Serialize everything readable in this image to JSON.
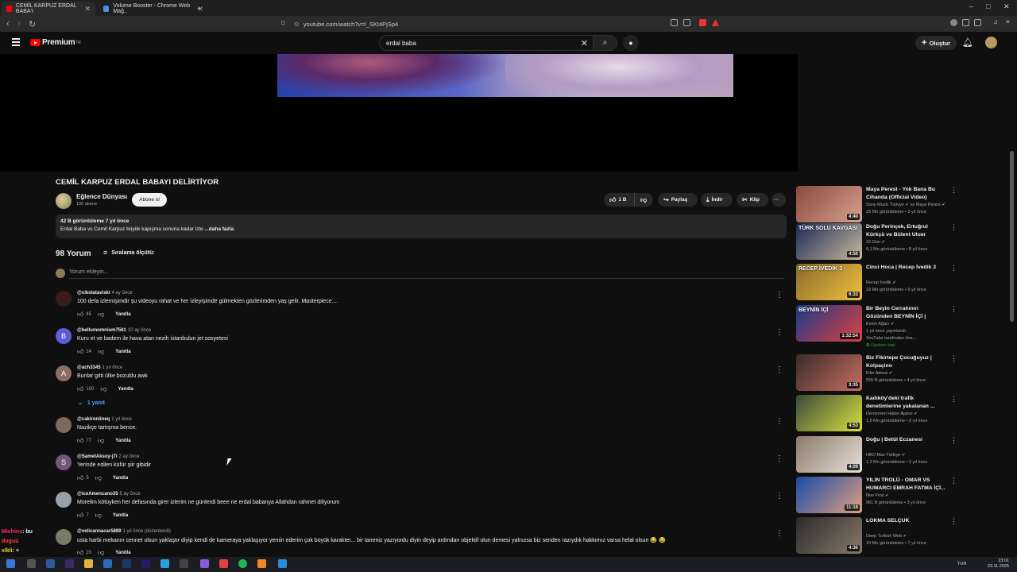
{
  "browser": {
    "tabs": [
      {
        "label": "CEMİL KARPUZ ERDAL BABA'I",
        "active": true
      },
      {
        "label": "Volume Booster - Chrome Web Mağ..",
        "active": false
      }
    ],
    "new_tab": "+",
    "url": "youtube.com/watch?v=I_SKt4PjSp4",
    "window_controls": [
      "–",
      "□",
      "✕"
    ]
  },
  "header": {
    "logo_text": "Premium",
    "logo_sup": "TR",
    "search_value": "erdal baba",
    "clear": "✕",
    "search_icon": "⌕",
    "mic_icon": "🎤",
    "create_label": "Oluştur",
    "create_icon": "+"
  },
  "video": {
    "title": "CEMİL KARPUZ ERDAL BABAYI DELİRTİYOR",
    "channel": "Eğlence Dünyası",
    "subscribers": "190 abone",
    "subscribe_label": "Abone ol",
    "actions": {
      "like": "1 B",
      "share": "Paylaş",
      "download": "İndir",
      "clip": "Klip",
      "more": "···"
    },
    "description": {
      "meta": "42 B görüntüleme  7 yıl önce",
      "text": "Erdal Baba vs Cemil Karpuz büyük kapışma sonuna kadar izle",
      "more": "...daha fazla"
    }
  },
  "comments": {
    "count": "98 Yorum",
    "sort_label": "Sıralama ölçütü:",
    "add_placeholder": "Yorum ekleyin...",
    "reply_label": "Yanıtla",
    "replies_link": "1 yanıt",
    "items": [
      {
        "user": "@cikolataviski",
        "time": "4 ay önce",
        "text": "100 defa izlemişimdir şu videoyu rahat ve her izleyişimde gülmekten gözlerimden yaş gelir. Masterpiece....",
        "likes": "45",
        "avatar": "",
        "avatar_color": "#3a1a1a"
      },
      {
        "user": "@bellumomnium7561",
        "time": "10 ay önce",
        "text": "Kuru et ve badem ile hava atan nezih istanbulun jet sosyetesi",
        "likes": "24",
        "avatar": "B",
        "avatar_color": "#5c5cd6"
      },
      {
        "user": "@ach3345",
        "time": "1 yıl önce",
        "text": "Bunlar gitti ülke bozuldu awk",
        "likes": "100",
        "avatar": "A",
        "avatar_color": "#8d6e63"
      },
      {
        "user": "@cakironlineq",
        "time": "1 yıl önce",
        "text": "Nazikçe tartışma bence.",
        "likes": "77",
        "avatar": "",
        "avatar_color": "#7a6a60"
      },
      {
        "user": "@SametAksoy-j7i",
        "time": "2 ay önce",
        "text": "Yerinde edilen küfür şiir gibidir",
        "likes": "5",
        "avatar": "S",
        "avatar_color": "#6d5a7a"
      },
      {
        "user": "@iceAmencano35",
        "time": "5 ay önce",
        "text": "Morelim kötüyken her defasında girer izlerim ne günlerdi beee ne erdal babanya Allahdan rahmet diliyorum",
        "likes": "7",
        "avatar": "",
        "avatar_color": "#9aa0a8"
      },
      {
        "user": "@velicannacar5889",
        "time": "1 yıl önce (düzenlendi)",
        "text": "usta harbi mekanın cennet olsun yaklaştır diyip kendi de kameraya yaklaşıyor yemin ederim çok büyük karakter... bir taneniz yazıyordu diyin deyip ardından objektif olun demesi yalnızsa biz senden razıydık hakkımız varsa helal olsun 😂 😂",
        "likes": "20",
        "avatar": "",
        "avatar_color": "#7a7a6a"
      }
    ]
  },
  "sidebar": [
    {
      "title": "Maya Perest - Yok Bana Bu Cihanda (Official Video)",
      "channel": "Sony Music Türkiye ✔ ve Maya Perest ✔",
      "meta": "25 Mn görüntüleme • 3 yıl önce",
      "duration": "4:40",
      "thumb": "#8a4a3a",
      "thumb2": "#d8a090"
    },
    {
      "title": "Doğu Perinçek, Ertuğrul Kürkçü ve Bülent Uluer Kavgası | ...",
      "channel": "32.Gün ✔",
      "meta": "6,1 Mn görüntüleme • 8 yıl önce",
      "duration": "4:50",
      "thumb": "#1a2a5a",
      "thumb2": "#c9b89a",
      "overlay": "TÜRK SOLU KAVGASI"
    },
    {
      "title": "Cinci Hoca | Recep İvedik 3",
      "channel": "Recep İvedik ✔",
      "meta": "19 Mn görüntüleme • 9 yıl önce",
      "duration": "6:32",
      "thumb": "#8a6a2a",
      "thumb2": "#f0c040",
      "overlay": "RECEP İVEDİK 3"
    },
    {
      "title": "Bir Beyin Cerrahının Gözünden BEYNİN İÇİ | Mehmet Çağlar ...",
      "channel": "Evrim Ağacı ✔",
      "meta": "1 yıl önce yayınlandı",
      "meta2": "YouTube tarafından öne...",
      "badge": "✪ Üyelere özel",
      "duration": "1:32:54",
      "thumb": "#1a3a8a",
      "thumb2": "#e04040",
      "overlay": "BEYNİN İÇİ"
    },
    {
      "title": "Biz Fikirtepe Çocuğuyuz | Kolpaçino",
      "channel": "Film Adresi ✔",
      "meta": "555 B görüntüleme • 4 yıl önce",
      "duration": "3:35",
      "thumb": "#3a2a2a",
      "thumb2": "#c87060"
    },
    {
      "title": "Kadıköy'deki trafik denetimlerine yakalanan ...",
      "channel": "Demirören Haber Ajansı ✔",
      "meta": "1,5 Mn görüntüleme • 2 yıl önce",
      "duration": "4:53",
      "thumb": "#3a4a3a",
      "thumb2": "#d8e040"
    },
    {
      "title": "Doğu | Betül Eczanesi",
      "channel": "HBO Max Türkiye ✔",
      "meta": "1,2 Mn görüntüleme • 2 yıl önce",
      "duration": "4:09",
      "thumb": "#8a7a6a",
      "thumb2": "#e8e0d8"
    },
    {
      "title": "YILIN TROLÜ - OMAR VS HUMARCI EMRAH FATMA İÇİ...",
      "channel": "İlker First ✔",
      "meta": "961 B görüntüleme • 3 yıl önce",
      "duration": "11:18",
      "thumb": "#1a4aa8",
      "thumb2": "#e0a080"
    },
    {
      "title": "LOKMA SELÇUK",
      "channel": "Deep Turkish Web ✔",
      "meta": "10 Mn görüntüleme • 7 yıl önce",
      "duration": "4:30",
      "thumb": "#2a2a2a",
      "thumb2": "#8a7a6a"
    }
  ],
  "chat_overlay": [
    {
      "user": "Michins",
      "text": ": bu"
    },
    {
      "user": "doguŭ",
      "text": ""
    },
    {
      "user": "xlkli",
      "text": ": ≡"
    },
    {
      "user": "xlkbr",
      "text": ""
    }
  ],
  "taskbar": {
    "lang": "TUR",
    "time": "23:01",
    "date": "23.11.2025"
  }
}
